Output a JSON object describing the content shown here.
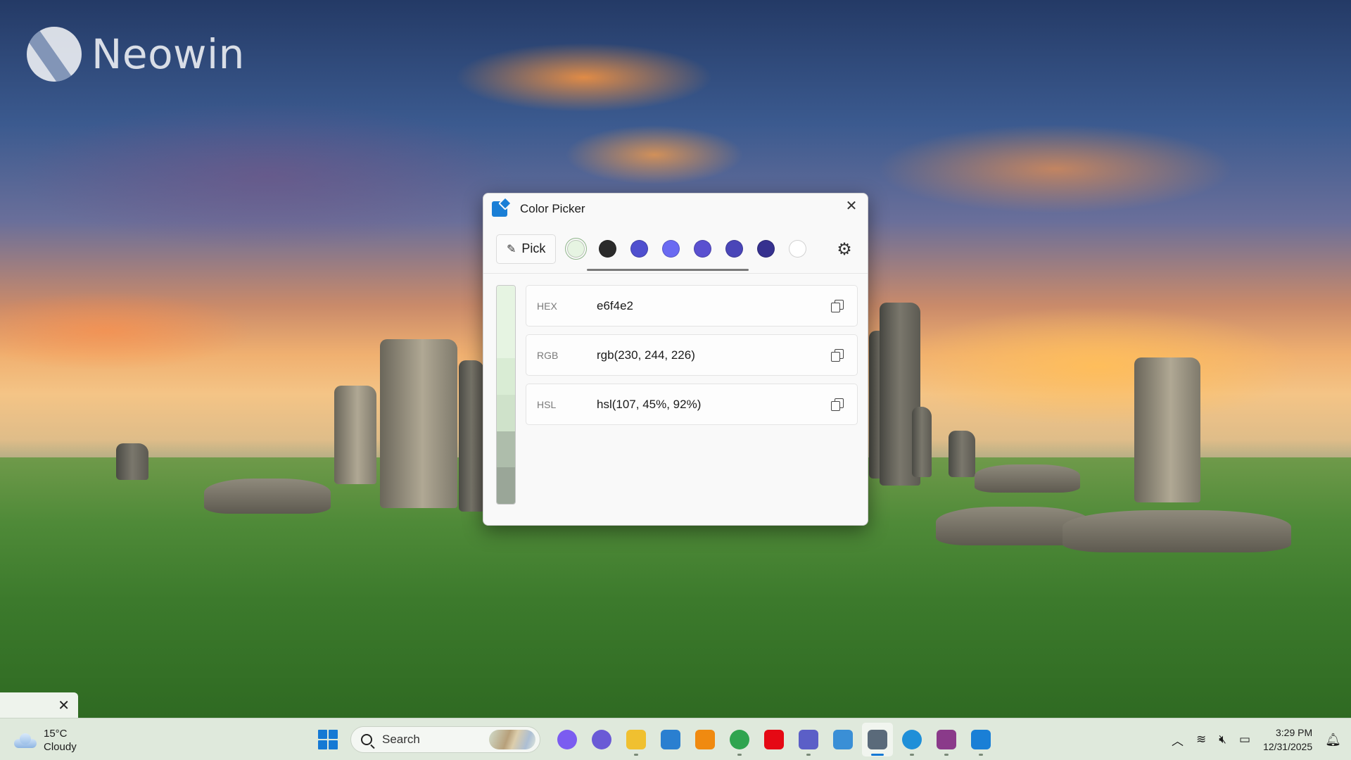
{
  "wallpaper": {
    "brand": "Neowin"
  },
  "window": {
    "title": "Color Picker",
    "pick_label": "Pick",
    "swatches": [
      "#e6f4e2",
      "#2b2b2b",
      "#4f4fcf",
      "#6a6af2",
      "#5a50d0",
      "#4a46b8",
      "#36318f",
      "#ffffff"
    ],
    "shades": [
      "#e6f4e2",
      "#e6f4e2",
      "#d9ecd4",
      "#cfe2ca",
      "#aebdab",
      "#9aa698"
    ],
    "fields": [
      {
        "label": "HEX",
        "value": "e6f4e2"
      },
      {
        "label": "RGB",
        "value": "rgb(230, 244, 226)"
      },
      {
        "label": "HSL",
        "value": "hsl(107, 45%, 92%)"
      }
    ]
  },
  "taskbar": {
    "weather": {
      "temp": "15°C",
      "condition": "Cloudy"
    },
    "search_placeholder": "Search",
    "apps": [
      {
        "name": "copilot",
        "color": "#7b5cf0"
      },
      {
        "name": "arc",
        "color": "#6a5ad6"
      },
      {
        "name": "file-explorer",
        "color": "#f0c030"
      },
      {
        "name": "photos",
        "color": "#2a7fd0"
      },
      {
        "name": "vlc",
        "color": "#f08a10"
      },
      {
        "name": "chrome",
        "color": "#2fa44f"
      },
      {
        "name": "netflix",
        "color": "#e50914"
      },
      {
        "name": "teams",
        "color": "#5b5fc7"
      },
      {
        "name": "snipping-tool",
        "color": "#3a8fd6"
      },
      {
        "name": "powertoys",
        "color": "#5a6a7a"
      },
      {
        "name": "edge",
        "color": "#1f8fd8"
      },
      {
        "name": "winrar",
        "color": "#8a3a8a"
      },
      {
        "name": "color-picker",
        "color": "#1a7fd6"
      }
    ],
    "time": "3:29 PM",
    "date": "12/31/2025"
  }
}
